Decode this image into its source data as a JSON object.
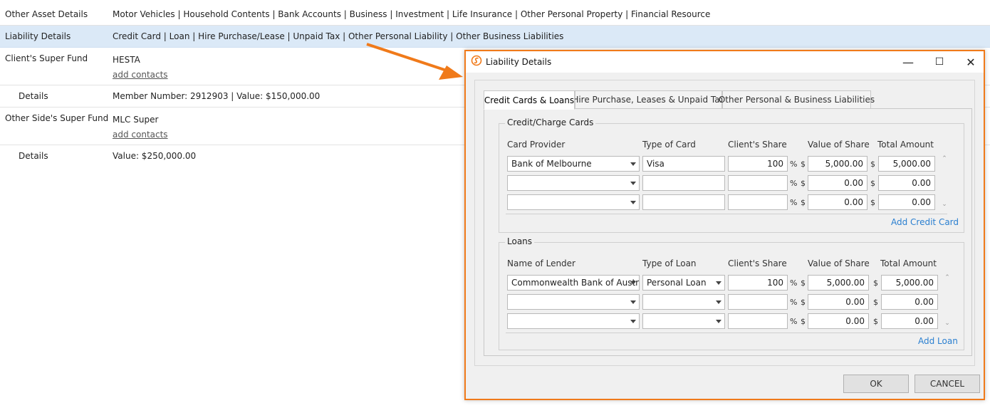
{
  "background": {
    "rows": [
      {
        "label": "Other Asset Details",
        "value": "Motor Vehicles | Household Contents | Bank Accounts | Business | Investment | Life Insurance | Other Personal Property | Financial Resource"
      },
      {
        "label": "Liability Details",
        "value": "Credit Card | Loan | Hire Purchase/Lease | Unpaid Tax | Other Personal Liability | Other Business Liabilities"
      },
      {
        "label": "Client's Super Fund",
        "value": "HESTA",
        "link": "add contacts"
      },
      {
        "label": "Details",
        "value": "Member Number: 2912903 | Value: $150,000.00"
      },
      {
        "label": "Other Side's Super Fund",
        "value": "MLC Super",
        "link": "add contacts"
      },
      {
        "label": "Details",
        "value": "Value: $250,000.00"
      }
    ]
  },
  "dialog": {
    "title": "Liability Details",
    "window_controls": {
      "minimize": "—",
      "maximize": "☐",
      "close": "✕"
    },
    "tabs": [
      {
        "label": "Credit Cards & Loans",
        "active": true
      },
      {
        "label": "Hire Purchase, Leases & Unpaid Tax",
        "active": false
      },
      {
        "label": "Other Personal & Business Liabilities",
        "active": false
      }
    ],
    "credit_cards": {
      "legend": "Credit/Charge Cards",
      "headers": [
        "Card Provider",
        "Type of Card",
        "Client's Share",
        "Value of Share",
        "Total Amount"
      ],
      "rows": [
        {
          "provider": "Bank of Melbourne",
          "type": "Visa",
          "share": "100",
          "value": "5,000.00",
          "total": "5,000.00"
        },
        {
          "provider": "",
          "type": "",
          "share": "",
          "value": "0.00",
          "total": "0.00"
        },
        {
          "provider": "",
          "type": "",
          "share": "",
          "value": "0.00",
          "total": "0.00"
        }
      ],
      "add_label": "Add Credit Card"
    },
    "loans": {
      "legend": "Loans",
      "headers": [
        "Name of Lender",
        "Type of Loan",
        "Client's Share",
        "Value of Share",
        "Total Amount"
      ],
      "rows": [
        {
          "lender": "Commonwealth Bank of Austr",
          "type": "Personal Loan",
          "share": "100",
          "value": "5,000.00",
          "total": "5,000.00"
        },
        {
          "lender": "",
          "type": "",
          "share": "",
          "value": "0.00",
          "total": "0.00"
        },
        {
          "lender": "",
          "type": "",
          "share": "",
          "value": "0.00",
          "total": "0.00"
        }
      ],
      "add_label": "Add Loan"
    },
    "symbols": {
      "percent": "%",
      "dollar": "$",
      "scroll_up": "⌃",
      "scroll_down": "⌄"
    },
    "ok_label": "OK",
    "cancel_label": "CANCEL"
  },
  "colors": {
    "accent": "#f07a1a",
    "link": "#2a7fd0",
    "highlight_row": "#dbe9f7"
  }
}
